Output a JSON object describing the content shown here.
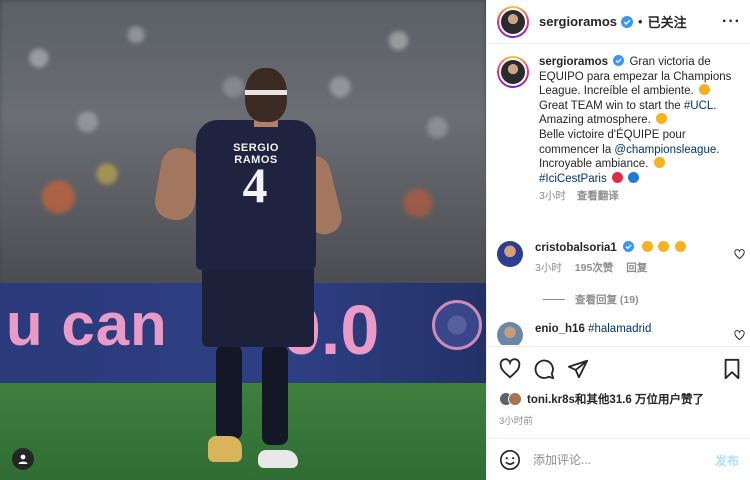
{
  "header": {
    "username": "sergioramos",
    "separator": "•",
    "follow_label": "已关注",
    "more_label": "···"
  },
  "photo": {
    "jersey_name": "SERGIO RAMOS",
    "jersey_number": "4",
    "board_left_text": "u can",
    "board_right_text": "0.0"
  },
  "caption": {
    "username": "sergioramos",
    "line1": "Gran victoria de EQUIPO para empezar la Champions League. Increíble el ambiente.",
    "line2_pre": "Great TEAM win to start the ",
    "line2_tag": "#UCL",
    "line2_post": ". Amazing atmosphere.",
    "line3_pre": "Belle victoire d'ÉQUIPE pour commencer la ",
    "line3_tag": "@championsleague",
    "line3_post": ". Incroyable ambiance.",
    "line4_tag": "#IciCestParis",
    "time": "3小时",
    "translate": "查看翻译"
  },
  "comments": [
    {
      "username": "cristobalsoria1",
      "text": "",
      "time": "3小时",
      "likes": "195次赞",
      "reply": "回复"
    },
    {
      "username": "enio_h16",
      "text": "#halamadrid"
    }
  ],
  "view_replies": "查看回复 (19)",
  "likes": {
    "text": "toni.kr8s和其他31.6 万位用户赞了"
  },
  "post_time": "3小时前",
  "add_comment": {
    "placeholder": "添加评论...",
    "post_label": "发布"
  },
  "colors": {
    "link": "#00376b",
    "verified": "#3897f0",
    "muted": "#8e8e8e",
    "post_disabled": "#b2dffc"
  },
  "icons": [
    "verified-icon",
    "more-icon",
    "heart-icon",
    "comment-icon",
    "share-icon",
    "save-icon",
    "smile-icon",
    "user-tag-icon"
  ]
}
